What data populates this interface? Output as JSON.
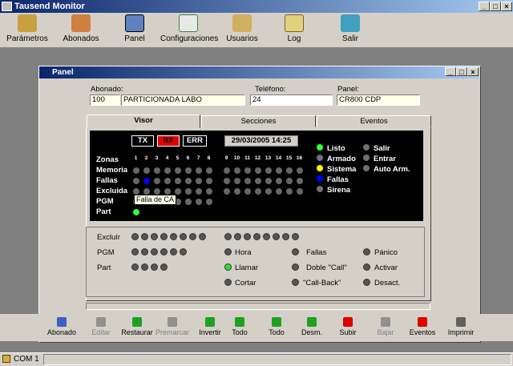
{
  "app": {
    "title": "Tausend Monitor"
  },
  "toolbar": [
    {
      "label": "Parámetros",
      "icon": "parameters-icon"
    },
    {
      "label": "Abonados",
      "icon": "subscribers-icon"
    },
    {
      "label": "Panel",
      "icon": "panel-icon"
    },
    {
      "label": "Configuraciones",
      "icon": "configurations-icon"
    },
    {
      "label": "Usuarios",
      "icon": "users-icon"
    },
    {
      "label": "Log",
      "icon": "log-icon"
    },
    {
      "label": "Salir",
      "icon": "exit-icon"
    }
  ],
  "panel": {
    "title": "Panel",
    "abonado_label": "Abonado:",
    "abonado_num": "100",
    "abonado_name": "PARTICIONADA LABO",
    "telefono_label": "Teléfono:",
    "telefono": "24",
    "panel_label": "Panel:",
    "panel_model": "CR800 CDP"
  },
  "tabs": [
    "Visor",
    "Secciones",
    "Eventos"
  ],
  "visor": {
    "tx": "TX",
    "rx": "RX",
    "err": "ERR",
    "datetime": "29/03/2005 14:25",
    "rows": [
      "Zonas",
      "Memoria",
      "Fallas",
      "Excluida",
      "PGM",
      "Part"
    ],
    "numbers_a": [
      "1",
      "2",
      "3",
      "4",
      "5",
      "6",
      "7",
      "8"
    ],
    "numbers_b": [
      "9",
      "10",
      "11",
      "12",
      "13",
      "14",
      "15",
      "16"
    ],
    "tooltip": "Falla de CA",
    "legend_left": [
      {
        "label": "Listo",
        "color": "#33ff33"
      },
      {
        "label": "Armado",
        "color": "#707070"
      },
      {
        "label": "Sistema",
        "color": "#ffff00"
      },
      {
        "label": "Fallas",
        "color": "#0000ff"
      },
      {
        "label": "Sirena",
        "color": "#707070"
      }
    ],
    "legend_right": [
      "Salir",
      "Entrar",
      "Auto Arm."
    ]
  },
  "controls": {
    "excluir": "Excluír",
    "pgm": "PGM",
    "part": "Part",
    "hora": "Hora",
    "llamar": "Llamar",
    "cortar": "Cortar",
    "fallas": "Fallas",
    "doble_call": "Doble \"Call\"",
    "call_back": "\"Call-Back\"",
    "panico": "Pánico",
    "activar": "Activar",
    "desact": "Desact."
  },
  "bottom_toolbar": [
    {
      "label": "Abonado",
      "enabled": true
    },
    {
      "label": "Editar",
      "enabled": false
    },
    {
      "label": "Restaurar",
      "enabled": true
    },
    {
      "label": "Premarcar",
      "enabled": false
    },
    {
      "label": "Invertir",
      "enabled": true
    },
    {
      "label": "Todo",
      "enabled": true
    },
    {
      "label": "Todo",
      "enabled": true
    },
    {
      "label": "Desm.",
      "enabled": true
    },
    {
      "label": "Subir",
      "enabled": true
    },
    {
      "label": "Bajar",
      "enabled": false
    },
    {
      "label": "Eventos",
      "enabled": true
    },
    {
      "label": "Imprimir",
      "enabled": true
    }
  ],
  "status": {
    "port": "COM 1"
  }
}
